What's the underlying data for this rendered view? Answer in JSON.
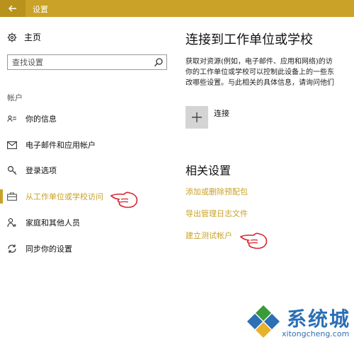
{
  "window": {
    "title": "设置"
  },
  "sidebar": {
    "home_label": "主页",
    "search_placeholder": "查找设置",
    "section_label": "帐户",
    "items": [
      {
        "label": "你的信息",
        "icon": "contact-card-icon"
      },
      {
        "label": "电子邮件和应用帐户",
        "icon": "mail-icon"
      },
      {
        "label": "登录选项",
        "icon": "key-icon"
      },
      {
        "label": "从工作单位或学校访问",
        "icon": "briefcase-icon",
        "active": true
      },
      {
        "label": "家庭和其他人员",
        "icon": "person-add-icon"
      },
      {
        "label": "同步你的设置",
        "icon": "sync-icon"
      }
    ]
  },
  "main": {
    "title": "连接到工作单位或学校",
    "description_lines": [
      "获取对资源(例如，电子邮件、应用和网络)的访",
      "你的工作单位或学校可以控制此设备上的一些东",
      "改哪些设置。与此相关的具体信息，请询问他们"
    ],
    "connect_label": "连接",
    "related_title": "相关设置",
    "links": [
      "添加或删除预配包",
      "导出管理日志文件",
      "建立测试帐户"
    ]
  },
  "watermark": {
    "text_cn": "系统城",
    "text_en": "xitongcheng.com"
  },
  "colors": {
    "accent": "#c9a227",
    "watermark": "#2c6fb5"
  }
}
